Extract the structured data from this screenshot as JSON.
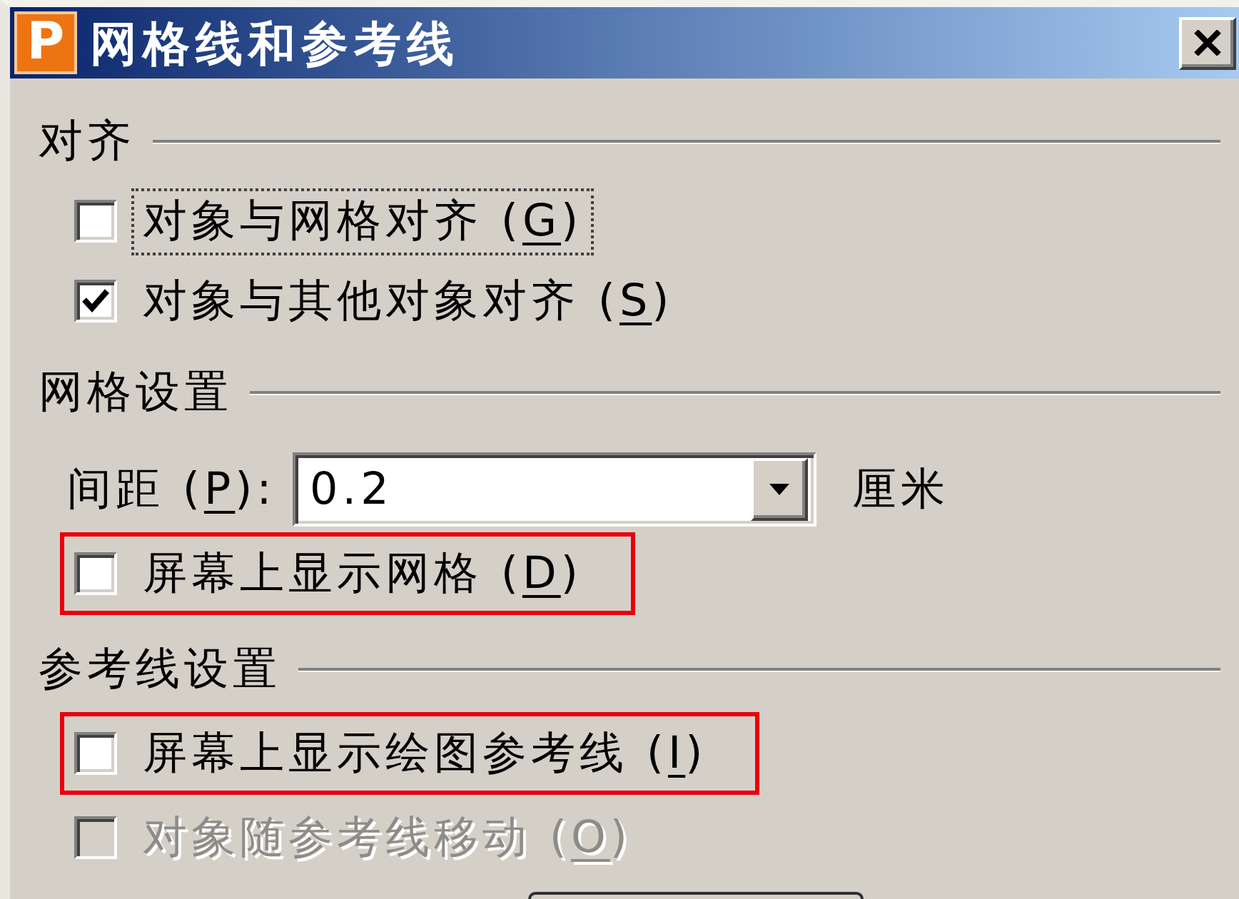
{
  "window": {
    "title": "网格线和参考线",
    "app_icon": "P"
  },
  "sections": [
    {
      "heading": "对齐",
      "items": [
        {
          "kind": "checkbox",
          "label": "对象与网格对齐",
          "access_key": "(G)",
          "checked": false,
          "focused": true,
          "disabled": false,
          "highlighted": false
        },
        {
          "kind": "checkbox",
          "label": "对象与其他对象对齐",
          "access_key": "(S)",
          "checked": true,
          "focused": false,
          "disabled": false,
          "highlighted": false
        }
      ]
    },
    {
      "heading": "网格设置",
      "items": [
        {
          "kind": "combo",
          "label": "间距",
          "access_key": "(P)",
          "suffix": ":",
          "value": "0.2",
          "unit": "厘米"
        },
        {
          "kind": "checkbox",
          "label": "屏幕上显示网格",
          "access_key": "(D)",
          "checked": false,
          "focused": false,
          "disabled": false,
          "highlighted": true
        }
      ]
    },
    {
      "heading": "参考线设置",
      "items": [
        {
          "kind": "checkbox",
          "label": "屏幕上显示绘图参考线",
          "access_key": "(I)",
          "checked": false,
          "focused": false,
          "disabled": false,
          "highlighted": true
        },
        {
          "kind": "checkbox",
          "label": "对象随参考线移动",
          "access_key": "(O)",
          "checked": false,
          "focused": false,
          "disabled": true,
          "highlighted": false
        }
      ]
    }
  ]
}
